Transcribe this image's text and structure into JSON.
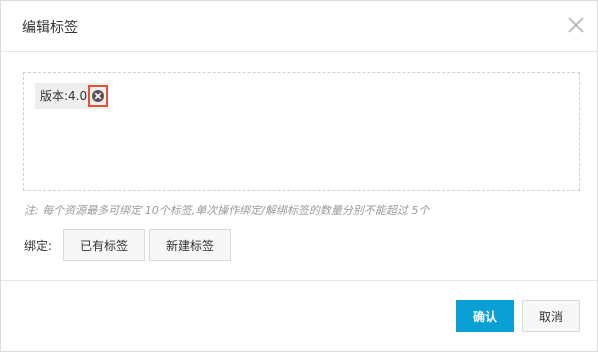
{
  "dialog": {
    "title": "编辑标签",
    "close_icon": "close-icon"
  },
  "tags": [
    {
      "text": "版本:4.0",
      "remove_icon": "remove-circle-icon"
    }
  ],
  "note": "注: 每个资源最多可绑定 10个标签,单次操作绑定/解绑标签的数量分别不能超过 5个",
  "bind": {
    "label": "绑定:",
    "existing_button": "已有标签",
    "new_button": "新建标签"
  },
  "footer": {
    "confirm_label": "确认",
    "cancel_label": "取消"
  },
  "colors": {
    "primary": "#0aa0d6",
    "highlight_border": "#e0553a"
  }
}
